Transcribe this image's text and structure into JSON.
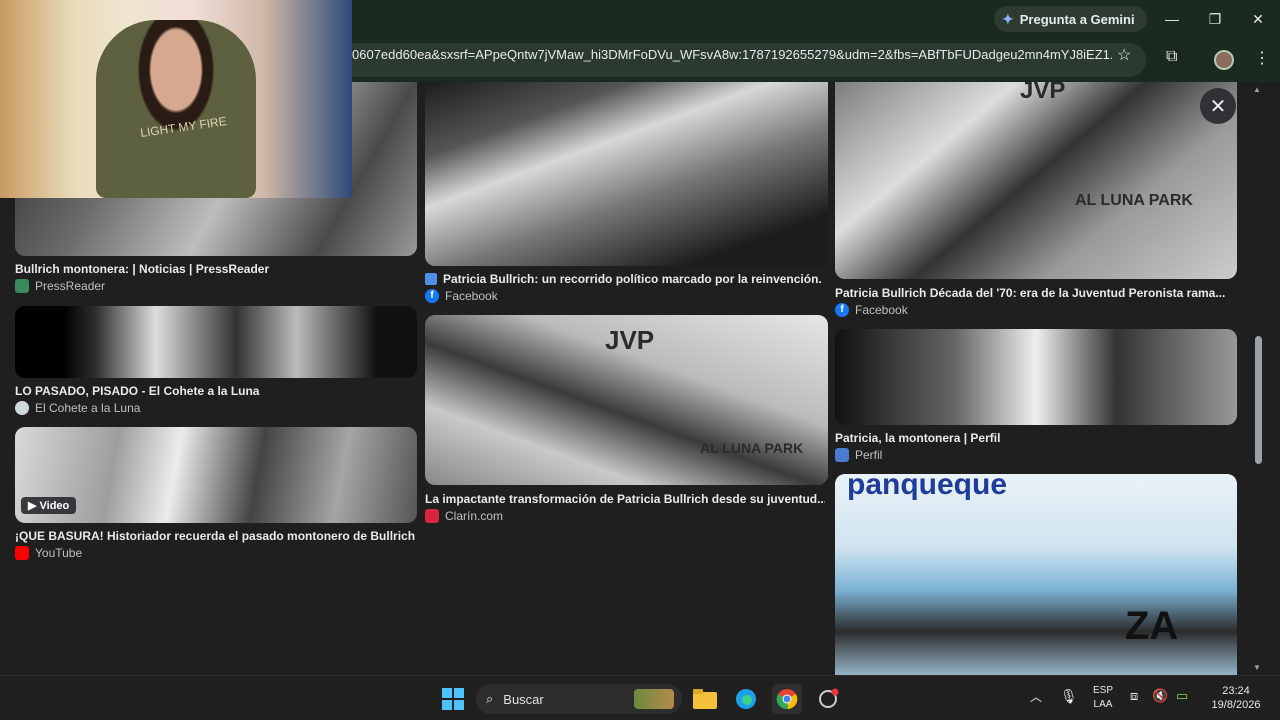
{
  "browser": {
    "gemini_button": "Pregunta a Gemini",
    "url": "0607edd60ea&sxsrf=APpeQntw7jVMaw_hi3DMrFoDVu_WFsvA8w:1787192655279&udm=2&fbs=ABfTbFUDadgeu2mn4mYJ8iEZ1..."
  },
  "webcam": {
    "shirt_text": "LIGHT MY FIRE"
  },
  "results": [
    {
      "title": "Bullrich montonera: | Noticias | PressReader",
      "source": "PressReader"
    },
    {
      "title": "Patricia Bullrich: un recorrido político marcado por la reinvención. ...",
      "source": "Facebook"
    },
    {
      "title": "Patricia Bullrich Década del '70: era de la Juventud Peronista rama...",
      "source": "Facebook"
    },
    {
      "title": "LO PASADO, PISADO - El Cohete a la Luna",
      "source": "El Cohete a la Luna"
    },
    {
      "title": "La impactante transformación de Patricia Bullrich desde su juventud...",
      "source": "Clarín.com"
    },
    {
      "title": "Patricia, la montonera | Perfil",
      "source": "Perfil"
    },
    {
      "title": "¡QUE BASURA! Historiador recuerda el pasado montonero de Bullrich y...",
      "source": "YouTube",
      "badge": "Video"
    }
  ],
  "image_text": {
    "jvp": "JVP",
    "luna_park": "AL LUNA PARK",
    "panqueque": "panqueque",
    "za": "ZA"
  },
  "taskbar": {
    "search_placeholder": "Buscar",
    "lang_top": "ESP",
    "lang_bottom": "LAA",
    "time": "23:24",
    "date": "19/8/2026"
  }
}
